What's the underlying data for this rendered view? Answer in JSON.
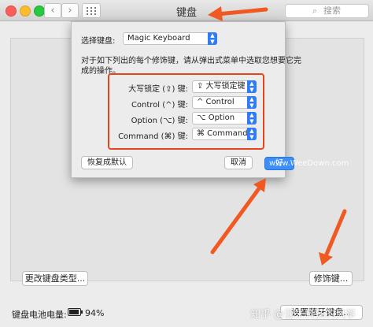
{
  "window": {
    "title": "键盘"
  },
  "toolbar": {
    "back_icon": "‹",
    "forward_icon": "›",
    "search_placeholder": "搜索",
    "search_icon": "⌕"
  },
  "dialog": {
    "select_label": "选择键盘:",
    "keyboard_value": "Magic Keyboard",
    "instruction_line1": "对于如下列出的每个修饰键，请从弹出式菜单中选取您想要它完",
    "instruction_line2": "成的操作。",
    "rows": [
      {
        "label": "大写锁定 (⇪) 键:",
        "value": "⇪ 大写锁定键"
      },
      {
        "label": "Control (^) 键:",
        "value": "^ Control"
      },
      {
        "label": "Option (⌥) 键:",
        "value": "⌥ Option"
      },
      {
        "label": "Command (⌘) 键:",
        "value": "⌘ Command"
      }
    ],
    "restore_defaults_label": "恢复成默认",
    "cancel_label": "取消",
    "ok_label": "好"
  },
  "main": {
    "change_keyboard_type_label": "更改键盘类型...",
    "modifier_keys_label": "修饰键...",
    "bluetooth_button_label": "设置蓝牙键盘..."
  },
  "footer": {
    "battery_label": "键盘电池电量:",
    "battery_percent": "94%",
    "battery_level": 0.94
  },
  "watermarks": {
    "top": "www.WeeDown.com",
    "bottom": "知乎 @亚米科技的风筝"
  },
  "colors": {
    "highlight_box": "#e5441d",
    "arrow": "#f05a22",
    "accent": "#2f7cf6"
  }
}
